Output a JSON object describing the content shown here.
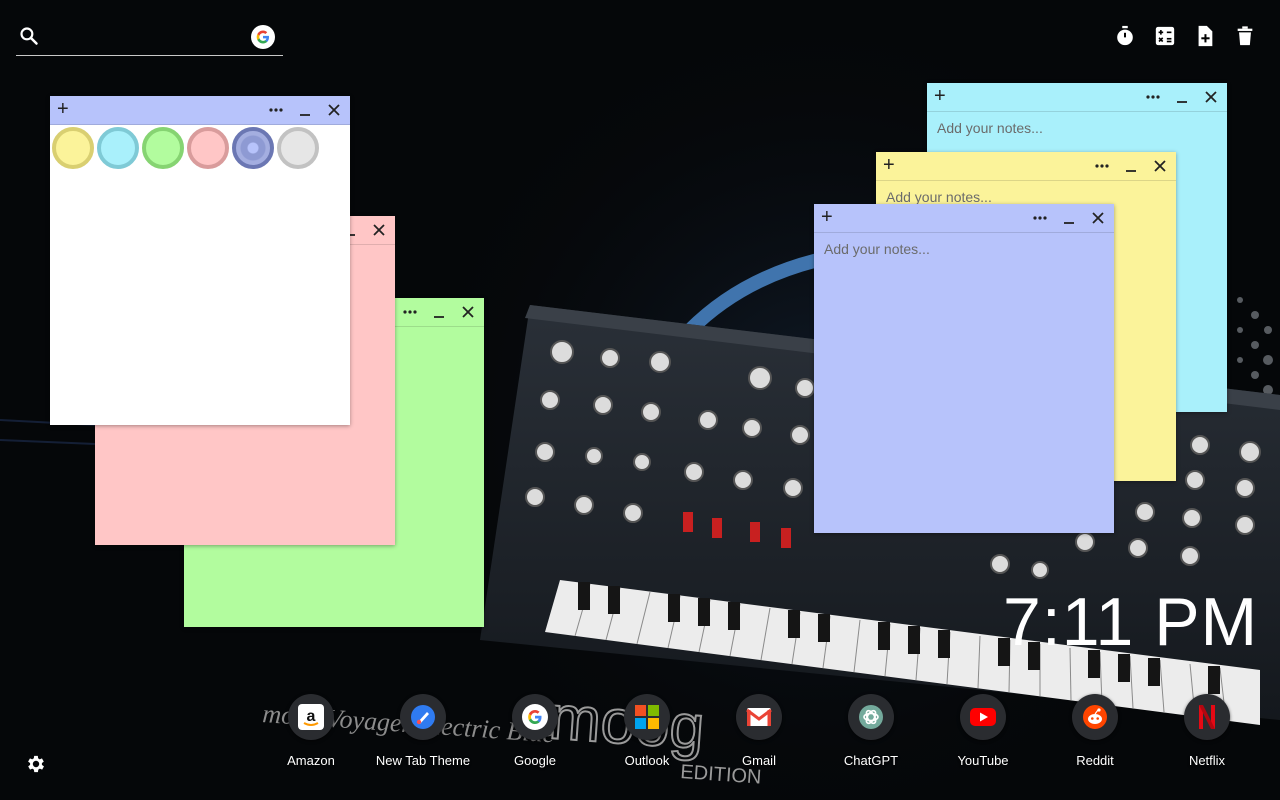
{
  "search": {
    "value": "",
    "placeholder": ""
  },
  "toolbar": {
    "items": [
      {
        "name": "timer-icon"
      },
      {
        "name": "calculator-icon"
      },
      {
        "name": "new-note-icon"
      },
      {
        "name": "trash-icon"
      }
    ]
  },
  "colors": {
    "yellow": "#fbf39a",
    "cyan": "#a9f0fb",
    "green": "#b2fc9e",
    "pink": "#ffc6c6",
    "blue": "#b7c3fb",
    "white": "#ffffff"
  },
  "notes": {
    "placeholder": "Add your notes...",
    "palette": [
      {
        "name": "yellow",
        "fill": "#fbf39a",
        "ring": "#d9cf71"
      },
      {
        "name": "cyan",
        "fill": "#a9f0fb",
        "ring": "#7fcad6"
      },
      {
        "name": "green",
        "fill": "#b2fc9e",
        "ring": "#86d472"
      },
      {
        "name": "pink",
        "fill": "#ffc6c6",
        "ring": "#d99c9c"
      },
      {
        "name": "blue",
        "fill": "#8e9ad3",
        "ring": "#6b77b3",
        "selected": true
      },
      {
        "name": "gray",
        "fill": "#e6e6e6",
        "ring": "#c2c2c2"
      }
    ]
  },
  "clock": {
    "time": "7:11 PM"
  },
  "dock": {
    "items": [
      {
        "label": "Amazon",
        "icon": "amazon-icon"
      },
      {
        "label": "New Tab Theme",
        "icon": "new-tab-theme-icon"
      },
      {
        "label": "Google",
        "icon": "google-icon"
      },
      {
        "label": "Outlook",
        "icon": "outlook-icon"
      },
      {
        "label": "Gmail",
        "icon": "gmail-icon"
      },
      {
        "label": "ChatGPT",
        "icon": "chatgpt-icon"
      },
      {
        "label": "YouTube",
        "icon": "youtube-icon"
      },
      {
        "label": "Reddit",
        "icon": "reddit-icon"
      },
      {
        "label": "Netflix",
        "icon": "netflix-icon"
      }
    ]
  },
  "wallpaper": {
    "brand": "moog",
    "caption": "moog Voyager Electric Blue",
    "edition": "EDITION"
  }
}
